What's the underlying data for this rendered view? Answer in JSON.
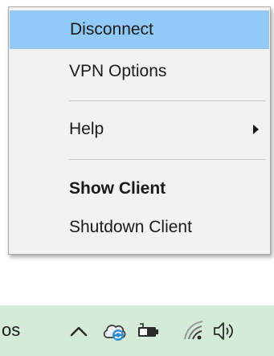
{
  "menu": {
    "items": [
      {
        "label": "Disconnect"
      },
      {
        "label": "VPN Options"
      },
      {
        "label": "Help"
      },
      {
        "label": "Show Client"
      },
      {
        "label": "Shutdown Client"
      }
    ],
    "highlight_color": "#91c9f7"
  },
  "taskbar": {
    "truncated_text": "os",
    "icons": [
      "chevron-up-icon",
      "vpn-client-icon",
      "battery-icon",
      "wifi-icon",
      "speaker-icon"
    ]
  }
}
